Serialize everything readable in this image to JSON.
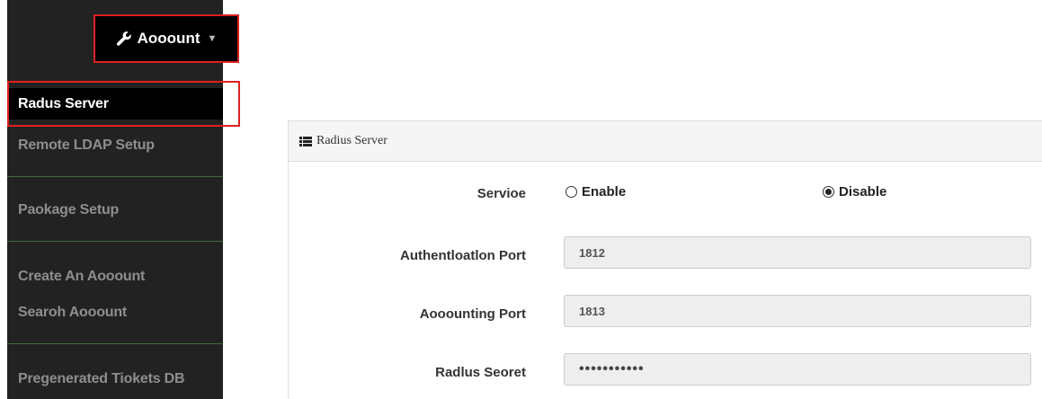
{
  "header": {
    "account_label": "Aooount",
    "account_icon": "wrench-icon"
  },
  "menu": {
    "items": [
      {
        "label": "Radus Server",
        "active": true
      },
      {
        "label": "Remote LDAP Setup"
      },
      {
        "label": "Paokage Setup"
      },
      {
        "label": "Create An Aooount"
      },
      {
        "label": "Searoh Aooount"
      },
      {
        "label": "Pregenerated Tiokets DB"
      }
    ]
  },
  "panel": {
    "title": "Radius Server",
    "title_icon": "list-icon",
    "service": {
      "label": "Servioe",
      "options": [
        {
          "label": "Enable",
          "checked": false
        },
        {
          "label": "Disable",
          "checked": true
        }
      ]
    },
    "auth_port": {
      "label": "Authentloatlon Port",
      "value": "1812"
    },
    "acct_port": {
      "label": "Aooounting Port",
      "value": "1813"
    },
    "secret": {
      "label": "Radlus Seoret",
      "value": "•••••••••••"
    }
  },
  "colors": {
    "menu_bg": "#222222",
    "highlight_border": "#e02020",
    "divider": "#3e6b3e",
    "field_bg": "#eeeeee"
  }
}
